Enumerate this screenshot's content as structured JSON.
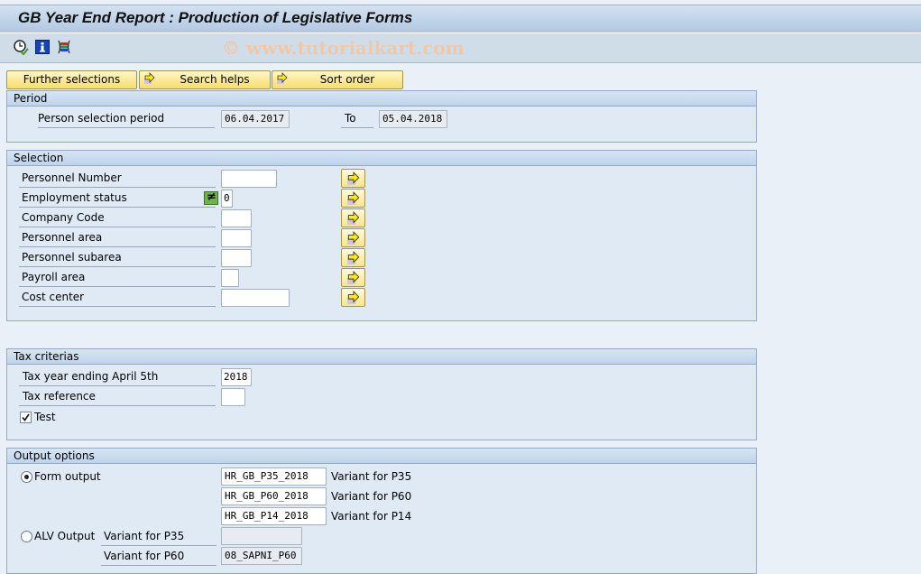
{
  "window": {
    "title": "GB Year End Report : Production of Legislative Forms"
  },
  "toolbar": {
    "icons": [
      "execute-clock-icon",
      "info-icon",
      "selection-options-icon"
    ],
    "watermark": "© www.tutorialkart.com"
  },
  "buttons": {
    "further_selections": "Further selections",
    "search_helps": "Search helps",
    "sort_order": "Sort order"
  },
  "period": {
    "header": "Period",
    "label": "Person selection period",
    "from": "06.04.2017",
    "to_label": "To",
    "to": "05.04.2018"
  },
  "selection": {
    "header": "Selection",
    "rows": [
      {
        "label": "Personnel Number",
        "value": ""
      },
      {
        "label": "Employment status",
        "value": "0",
        "option": "not-equal"
      },
      {
        "label": "Company Code",
        "value": ""
      },
      {
        "label": "Personnel area",
        "value": ""
      },
      {
        "label": "Personnel subarea",
        "value": ""
      },
      {
        "label": "Payroll area",
        "value": ""
      },
      {
        "label": "Cost center",
        "value": ""
      }
    ]
  },
  "tax": {
    "header": "Tax criterias",
    "year_label": "Tax year ending April 5th",
    "year": "2018",
    "ref_label": "Tax reference",
    "ref": "",
    "test_label": "Test",
    "test_checked": true
  },
  "output": {
    "header": "Output options",
    "form_output_label": "Form output",
    "form_output_selected": true,
    "form_variants": [
      {
        "value": "HR_GB_P35_2018",
        "label": "Variant for P35"
      },
      {
        "value": "HR_GB_P60_2018",
        "label": "Variant for P60"
      },
      {
        "value": "HR_GB_P14_2018",
        "label": "Variant for P14"
      }
    ],
    "alv_output_label": "ALV Output",
    "alv_variants": [
      {
        "label": "Variant for P35",
        "value": ""
      },
      {
        "label": "Variant for P60",
        "value": "08_SAPNI_P60"
      }
    ]
  }
}
